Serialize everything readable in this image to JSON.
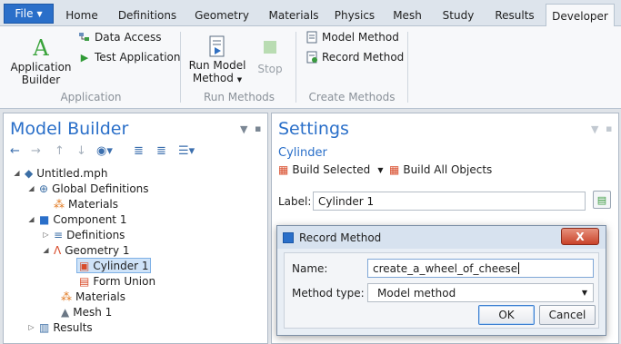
{
  "ribbon": {
    "file_tab": "File",
    "tabs": [
      "Home",
      "Definitions",
      "Geometry",
      "Materials",
      "Physics",
      "Mesh",
      "Study",
      "Results",
      "Developer"
    ],
    "active_tab": "Developer",
    "buttons": {
      "application_builder_line1": "Application",
      "application_builder_line2": "Builder",
      "data_access": "Data Access",
      "test_application": "Test Application",
      "run_model_method_line1": "Run Model",
      "run_model_method_line2": "Method",
      "stop": "Stop",
      "model_method": "Model Method",
      "record_method": "Record Method"
    },
    "groups": {
      "application": "Application",
      "run_methods": "Run Methods",
      "create_methods": "Create Methods"
    }
  },
  "model_builder": {
    "title": "Model Builder",
    "tree": [
      {
        "label": "Untitled.mph",
        "icon": "model-file-icon"
      },
      {
        "label": "Global Definitions",
        "icon": "globe-icon"
      },
      {
        "label": "Materials",
        "icon": "materials-icon"
      },
      {
        "label": "Component 1",
        "icon": "component-icon"
      },
      {
        "label": "Definitions",
        "icon": "definitions-icon"
      },
      {
        "label": "Geometry 1",
        "icon": "geometry-icon"
      },
      {
        "label": "Cylinder 1",
        "icon": "cylinder-icon"
      },
      {
        "label": "Form Union",
        "icon": "form-union-icon"
      },
      {
        "label": "Materials",
        "icon": "materials-icon"
      },
      {
        "label": "Mesh 1",
        "icon": "mesh-icon"
      },
      {
        "label": "Results",
        "icon": "results-icon"
      }
    ],
    "selected": "Cylinder 1"
  },
  "settings": {
    "title": "Settings",
    "subtitle": "Cylinder",
    "build_selected": "Build Selected",
    "build_all": "Build All Objects",
    "label_caption": "Label:",
    "label_value": "Cylinder 1"
  },
  "dialog": {
    "title": "Record Method",
    "close_label": "X",
    "name_label": "Name:",
    "name_value": "create_a_wheel_of_cheese",
    "method_type_label": "Method type:",
    "method_type_value": "Model method",
    "ok": "OK",
    "cancel": "Cancel"
  },
  "colors": {
    "accent": "#2a6fc9",
    "file_tab": "#2a6fc9",
    "close_button": "#c9432a",
    "selection": "#cfe3f8"
  }
}
